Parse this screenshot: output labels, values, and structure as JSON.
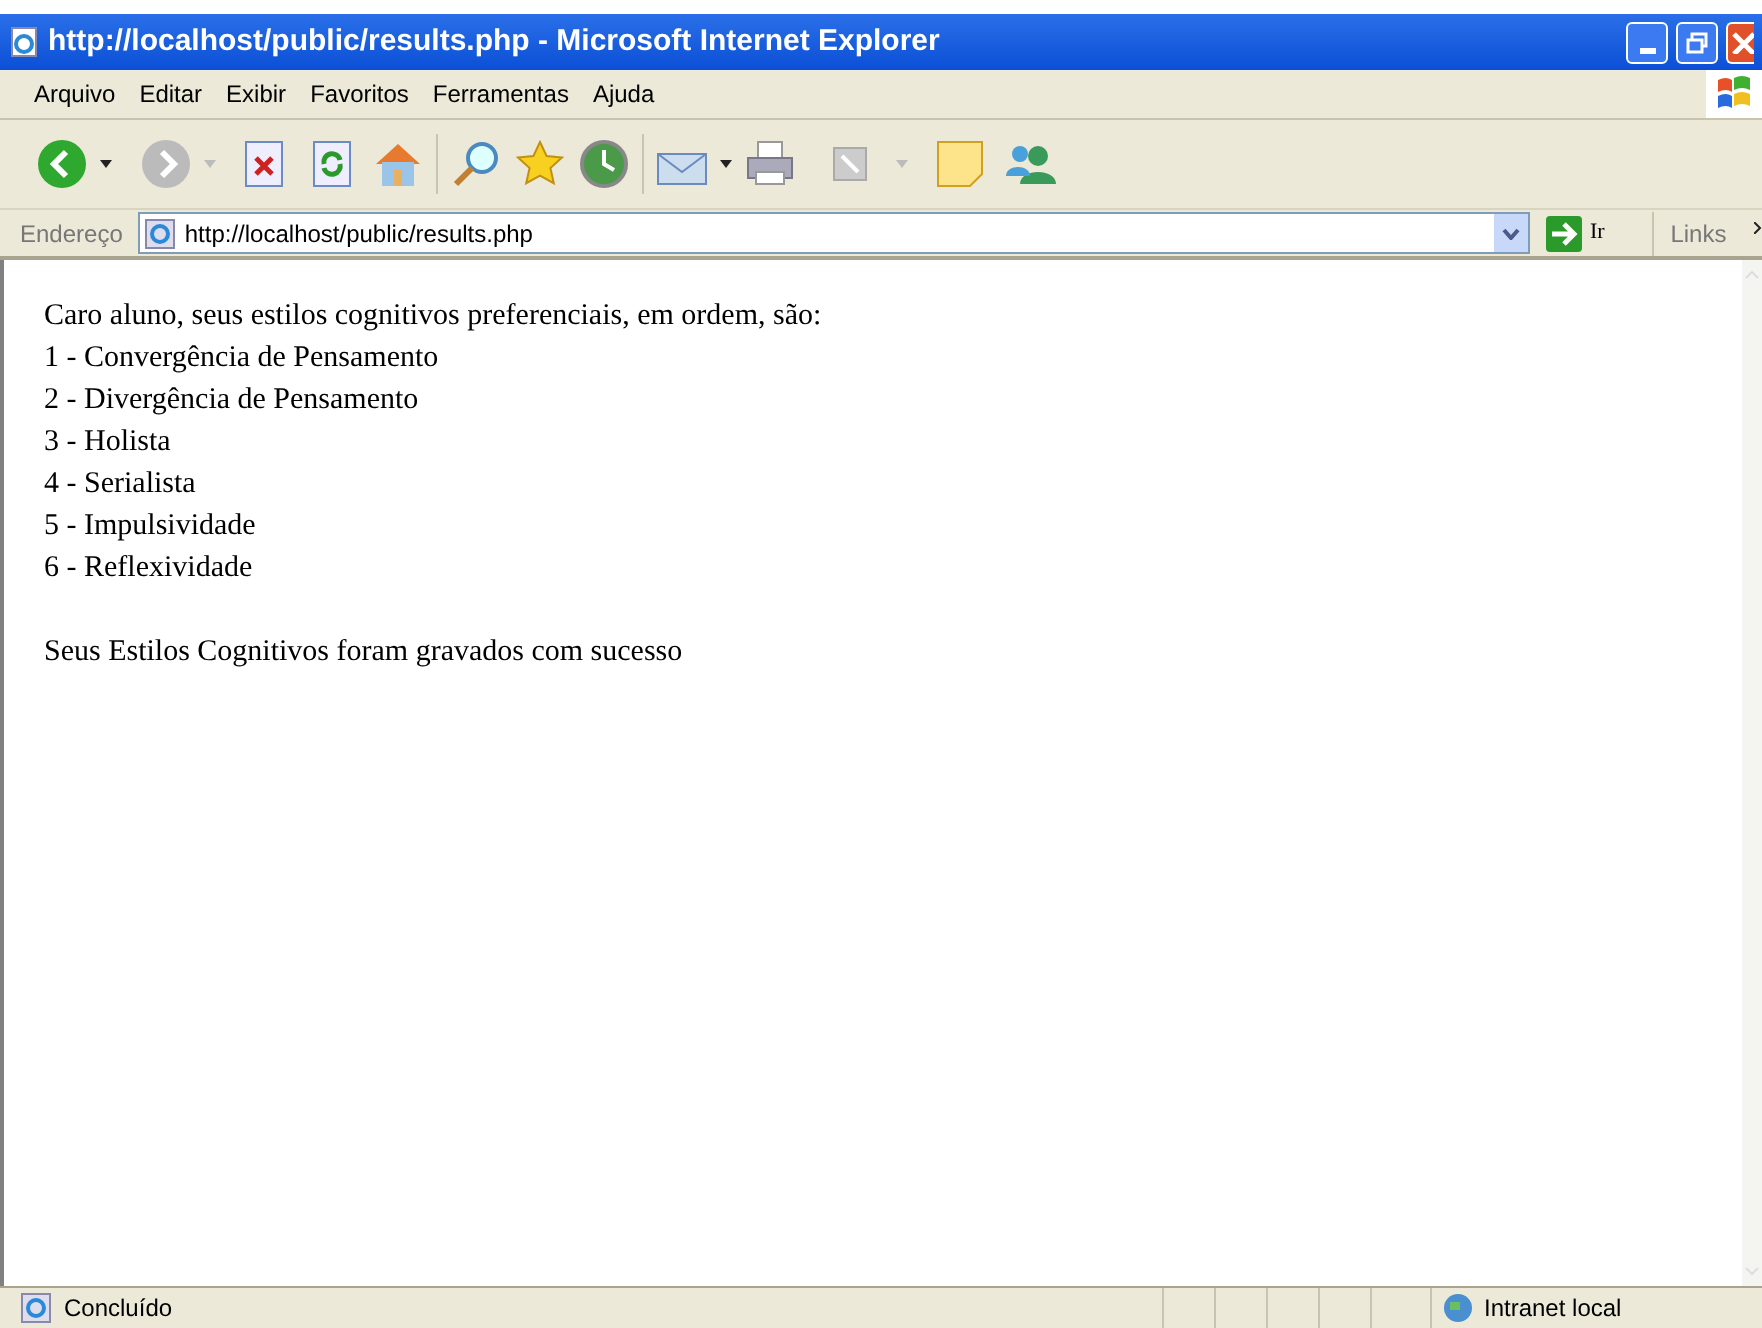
{
  "window": {
    "title": "http://localhost/public/results.php - Microsoft Internet Explorer"
  },
  "menu": [
    "Arquivo",
    "Editar",
    "Exibir",
    "Favoritos",
    "Ferramentas",
    "Ajuda"
  ],
  "address_bar": {
    "label": "Endereço",
    "url": "http://localhost/public/results.php",
    "go": "Ir",
    "links": "Links"
  },
  "page": {
    "intro": "Caro aluno, seus estilos cognitivos preferenciais, em ordem, são:",
    "items": [
      "1 - Convergência de Pensamento",
      "2 - Divergência de Pensamento",
      "3 - Holista",
      "4 - Serialista",
      "5 - Impulsividade",
      "6 - Reflexividade"
    ],
    "message": "Seus Estilos Cognitivos foram gravados com sucesso"
  },
  "status_bar": {
    "text": "Concluído",
    "zone": "Intranet local"
  }
}
